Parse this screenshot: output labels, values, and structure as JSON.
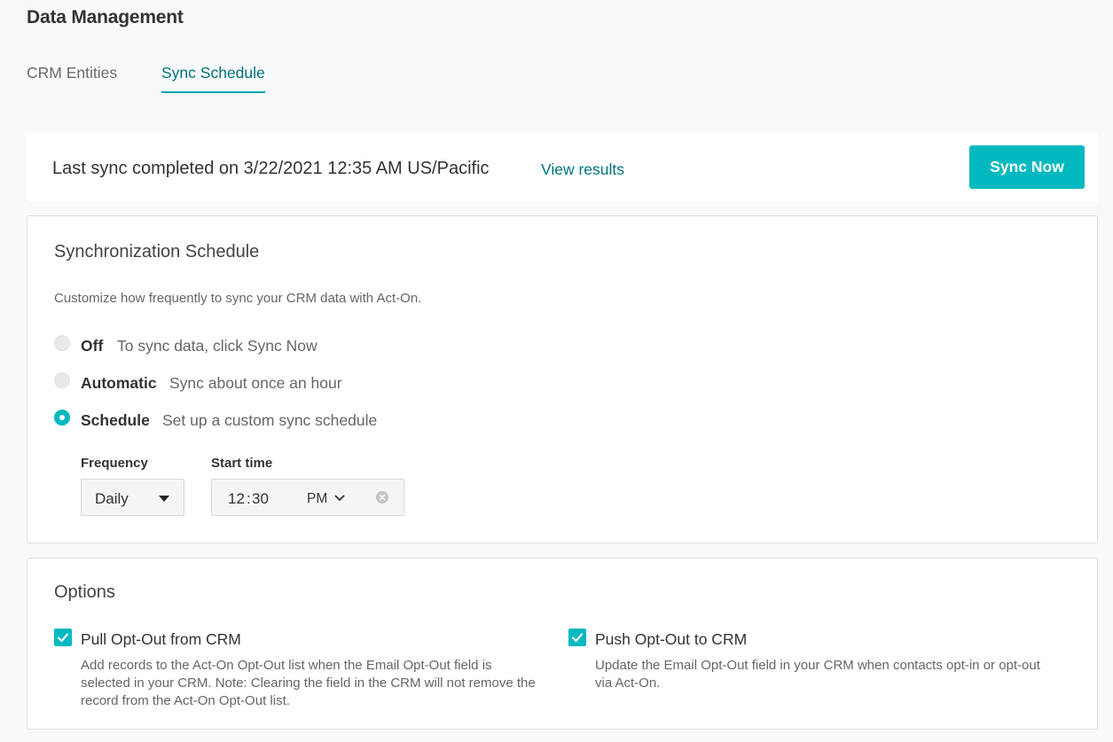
{
  "page": {
    "title": "Data Management"
  },
  "tabs": [
    {
      "label": "CRM Entities",
      "active": false
    },
    {
      "label": "Sync Schedule",
      "active": true
    }
  ],
  "sync_bar": {
    "status_text": "Last sync completed on 3/22/2021 12:35 AM US/Pacific",
    "view_results_label": "View results",
    "sync_now_label": "Sync Now"
  },
  "schedule": {
    "title": "Synchronization Schedule",
    "description": "Customize how frequently to sync your CRM data with Act-On.",
    "options": [
      {
        "label": "Off",
        "hint": "To sync data, click Sync Now",
        "selected": false
      },
      {
        "label": "Automatic",
        "hint": "Sync about once an hour",
        "selected": false
      },
      {
        "label": "Schedule",
        "hint": "Set up a custom sync schedule",
        "selected": true
      }
    ],
    "frequency": {
      "label": "Frequency",
      "value": "Daily"
    },
    "start_time": {
      "label": "Start time",
      "hour": "12",
      "separator": ":",
      "minute": "30",
      "period": "PM"
    }
  },
  "options": {
    "title": "Options",
    "items": [
      {
        "label": "Pull Opt-Out from CRM",
        "checked": true,
        "description": "Add records to the Act-On Opt-Out list when the Email Opt-Out field is selected in your CRM. Note: Clearing the field in the CRM will not remove the record from the Act-On Opt-Out list."
      },
      {
        "label": "Push Opt-Out to CRM",
        "checked": true,
        "description": "Update the Email Opt-Out field in your CRM when contacts opt-in or opt-out via Act-On."
      }
    ]
  },
  "colors": {
    "accent": "#00b9c0",
    "link": "#00727a",
    "background": "#f8f9fa"
  },
  "icons": {
    "period_dropdown": "chevron-down-icon",
    "clear_time": "clear-icon",
    "frequency_dropdown": "caret-down-icon",
    "checkbox_mark": "check-icon"
  }
}
